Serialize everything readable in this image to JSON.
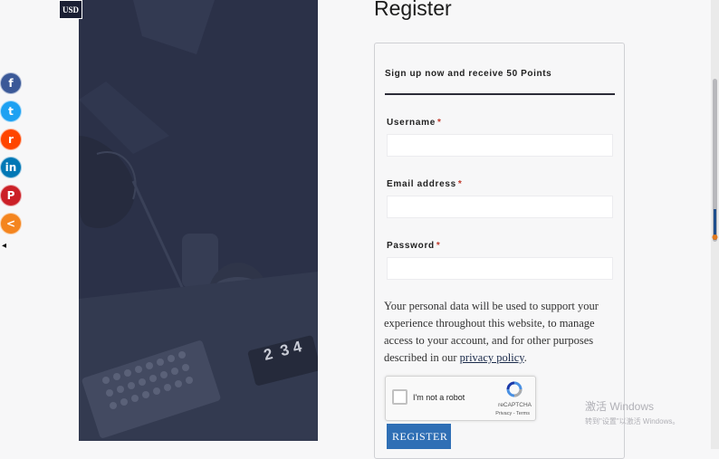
{
  "currency": {
    "label": "USD"
  },
  "share": {
    "buttons": [
      {
        "network": "facebook",
        "icon": "facebook-icon",
        "glyph": "f",
        "color": "#3b5998"
      },
      {
        "network": "twitter",
        "icon": "twitter-icon",
        "glyph": "t",
        "color": "#1da1f2"
      },
      {
        "network": "reddit",
        "icon": "reddit-icon",
        "glyph": "r",
        "color": "#ff4500"
      },
      {
        "network": "linkedin",
        "icon": "linkedin-icon",
        "glyph": "in",
        "color": "#0077b5"
      },
      {
        "network": "pinterest",
        "icon": "pinterest-icon",
        "glyph": "P",
        "color": "#cb2027"
      },
      {
        "network": "more",
        "icon": "share-icon",
        "glyph": "<",
        "color": "#f4851f"
      }
    ],
    "collapse_icon": "collapse-arrow-icon",
    "collapse_glyph": "◂"
  },
  "hero": {
    "keycap_text": "2  3 4"
  },
  "register": {
    "title": "Register",
    "subtitle": "Sign up now and receive 50 Points",
    "fields": {
      "username": {
        "label": "Username",
        "required": "*",
        "value": ""
      },
      "email": {
        "label": "Email address",
        "required": "*",
        "value": ""
      },
      "password": {
        "label": "Password",
        "required": "*",
        "value": ""
      }
    },
    "privacy": {
      "text": "Your personal data will be used to support your experience throughout this website, to manage access to your account, and for other purposes described in our ",
      "link": "privacy policy",
      "suffix": "."
    },
    "recaptcha": {
      "checkbox_label": "I'm not a robot",
      "brand": "reCAPTCHA",
      "terms": "Privacy - Terms"
    },
    "submit_label": "REGISTER"
  },
  "watermark": {
    "line1": "激活 Windows",
    "line2": "转到\"设置\"以激活 Windows。"
  },
  "colors": {
    "accent": "#2f6fb5",
    "hero_overlay": "#2b3148",
    "required": "#c0392b"
  }
}
